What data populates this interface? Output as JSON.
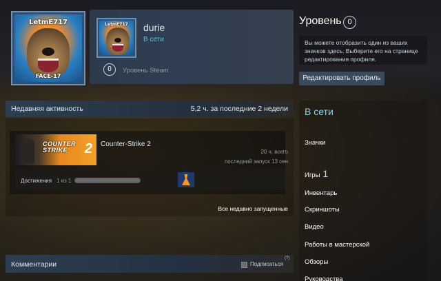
{
  "avatar": {
    "top_text": "LetmE717",
    "bottom_text": "FACE-17"
  },
  "mini_profile": {
    "name": "durie",
    "status": "В сети",
    "level": "0",
    "level_label": "Уровень Steam"
  },
  "sidebar": {
    "level_title": "Уровень",
    "level_value": "0",
    "badge_hint": "Вы можете отобразить один из ваших значков здесь. Выберите его на странице редактирования профиля.",
    "edit_button": "Редактировать профиль",
    "online_title": "В сети",
    "items": [
      {
        "label": "Значки",
        "count": ""
      },
      {
        "label": "Игры",
        "count": "1"
      },
      {
        "label": "Инвентарь",
        "count": ""
      },
      {
        "label": "Скриншоты",
        "count": ""
      },
      {
        "label": "Видео",
        "count": ""
      },
      {
        "label": "Работы в мастерской",
        "count": ""
      },
      {
        "label": "Обзоры",
        "count": ""
      },
      {
        "label": "Руководства",
        "count": ""
      }
    ]
  },
  "activity": {
    "title": "Недавняя активность",
    "hours_summary": "5,2 ч. за последние 2 недели",
    "game": {
      "name": "Counter-Strike 2",
      "capsule_line1": "COUNTER",
      "capsule_line2": "STRIKE",
      "capsule_num": "2",
      "hours_total": "20 ч. всего",
      "last_played": "последний запуск 13 сен",
      "achievements_label": "Достижения",
      "achievements_count": "1 из 1",
      "achievements_progress": 1.0
    },
    "recent_link": "Все недавно запущенные"
  },
  "comments": {
    "title": "Комментарии",
    "subscribe_label": "Подписаться",
    "help_mark": "(?)"
  },
  "colors": {
    "accent_online": "#57cbde",
    "header_blue": "#2d3e52",
    "capsule_orange": "#e8871e"
  }
}
